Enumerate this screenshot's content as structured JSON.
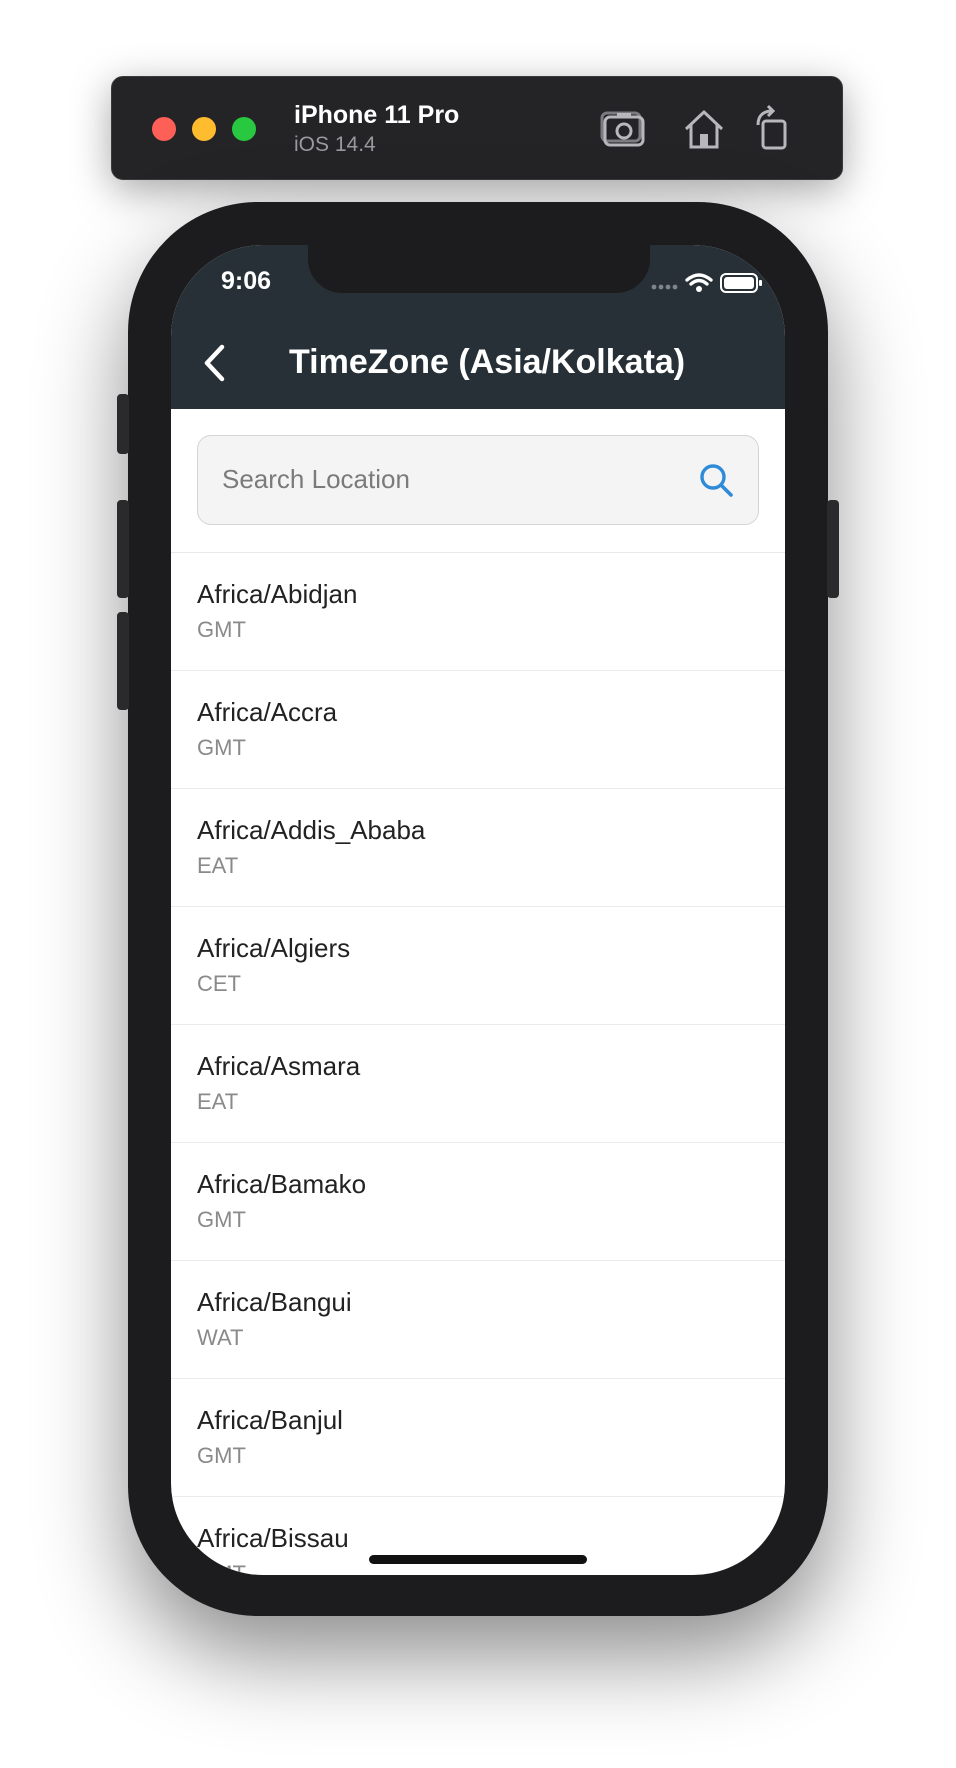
{
  "simulator": {
    "device_name": "iPhone 11 Pro",
    "os_version": "iOS 14.4",
    "buttons": [
      "screenshot-icon",
      "home-icon",
      "rotate-icon"
    ]
  },
  "status_bar": {
    "time": "9:06"
  },
  "app_bar": {
    "title": "TimeZone (Asia/Kolkata)"
  },
  "search": {
    "placeholder": "Search Location",
    "value": ""
  },
  "colors": {
    "app_bar": "#263036",
    "accent": "#2e8bd8"
  },
  "timezones": [
    {
      "name": "Africa/Abidjan",
      "abbr": "GMT"
    },
    {
      "name": "Africa/Accra",
      "abbr": "GMT"
    },
    {
      "name": "Africa/Addis_Ababa",
      "abbr": "EAT"
    },
    {
      "name": "Africa/Algiers",
      "abbr": "CET"
    },
    {
      "name": "Africa/Asmara",
      "abbr": "EAT"
    },
    {
      "name": "Africa/Bamako",
      "abbr": "GMT"
    },
    {
      "name": "Africa/Bangui",
      "abbr": "WAT"
    },
    {
      "name": "Africa/Banjul",
      "abbr": "GMT"
    },
    {
      "name": "Africa/Bissau",
      "abbr": "GMT"
    }
  ]
}
